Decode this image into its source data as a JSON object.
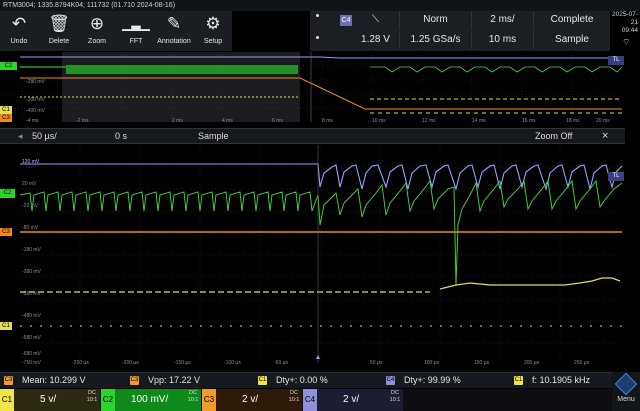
{
  "title": "RTM3004; 1335.8794K04; 111732 (01.710 2024-08-16)",
  "toolbar": [
    {
      "label": "Undo",
      "icon": "undo-icon"
    },
    {
      "label": "Delete",
      "icon": "trash-icon"
    },
    {
      "label": "Zoom",
      "icon": "zoom-icon"
    },
    {
      "label": "FFT",
      "icon": "fft-icon"
    },
    {
      "label": "Annotation",
      "icon": "pen-icon"
    },
    {
      "label": "Setup",
      "icon": "gear-icon"
    }
  ],
  "acquisition": {
    "trigger_source": "C4",
    "trigger_level": "1.28 V",
    "mode": "Norm",
    "sample_rate": "1.25 GSa/s",
    "timebase": "2 ms/",
    "record_length": "10 ms",
    "state": "Complete",
    "acq_mode": "Sample"
  },
  "datetime": {
    "date": "2025-07-21",
    "time": "09:44"
  },
  "overview": {
    "trace_labels": [
      "C2",
      "C1",
      "C3"
    ],
    "y_labels": [
      "-280 mV",
      "-300 mV",
      "-400 mV"
    ],
    "x_ticks": [
      "-4 ms",
      "-2 ms",
      "2 ms",
      "4 ms",
      "6 ms",
      "8 ms",
      "10 ms",
      "12 ms",
      "14 ms",
      "16 ms",
      "18 ms",
      "20 ms"
    ],
    "tl": "TL"
  },
  "zoombar": {
    "scale": "50 µs/",
    "position": "0 s",
    "mode": "Sample",
    "zoom_off": "Zoom Off",
    "close": "×"
  },
  "main": {
    "tl": "TL",
    "trace_labels": [
      "C2",
      "C3",
      "C1"
    ],
    "y_labels": [
      "120 mV",
      "20 mV",
      "-20 mV",
      "-80 mV",
      "-180 mV",
      "-280 mV",
      "-380 mV",
      "-480 mV",
      "-580 mV",
      "-680 mV"
    ],
    "x_ticks": [
      "-250 µs",
      "-200 µs",
      "-150 µs",
      "-100 µs",
      "-50 µs",
      "50 µs",
      "100 µs",
      "150 µs",
      "200 µs",
      "250 µs"
    ],
    "x_left": "-750 mV"
  },
  "measurements": [
    {
      "chip": "C3",
      "text": "Mean: 10.299 V",
      "color": "#f39a2b"
    },
    {
      "chip": "C3",
      "text": "Vpp: 17.22 V",
      "color": "#f39a2b"
    },
    {
      "chip": "C1",
      "text": "Dty+: 0.00 %",
      "color": "#f0e54a"
    },
    {
      "chip": "C4",
      "text": "Dty+: 99.99 %",
      "color": "#8f8fdc"
    },
    {
      "chip": "C1",
      "text": "f: 10.1905 kHz",
      "color": "#f0e54a"
    }
  ],
  "channels": [
    {
      "tag": "C1",
      "value": "5 v/",
      "coupling": "DC",
      "ratio": "10:1",
      "color": "#f0e54a",
      "bg": "#2b2a10"
    },
    {
      "tag": "C2",
      "value": "100 mV/",
      "coupling": "DC",
      "ratio": "10:1",
      "color": "#2bd42b",
      "bg": "#0f8a1a"
    },
    {
      "tag": "C3",
      "value": "2 v/",
      "coupling": "DC",
      "ratio": "10:1",
      "color": "#f39a2b",
      "bg": "#2d1a08"
    },
    {
      "tag": "C4",
      "value": "2 v/",
      "coupling": "DC",
      "ratio": "10:1",
      "color": "#8f8fdc",
      "bg": "#1c1c33"
    }
  ],
  "menu": {
    "label": "Menu"
  },
  "colors": {
    "ch1": "#f0e54a",
    "ch2": "#3fe03f",
    "ch3": "#f08a1c",
    "ch4": "#9aa0ff"
  }
}
